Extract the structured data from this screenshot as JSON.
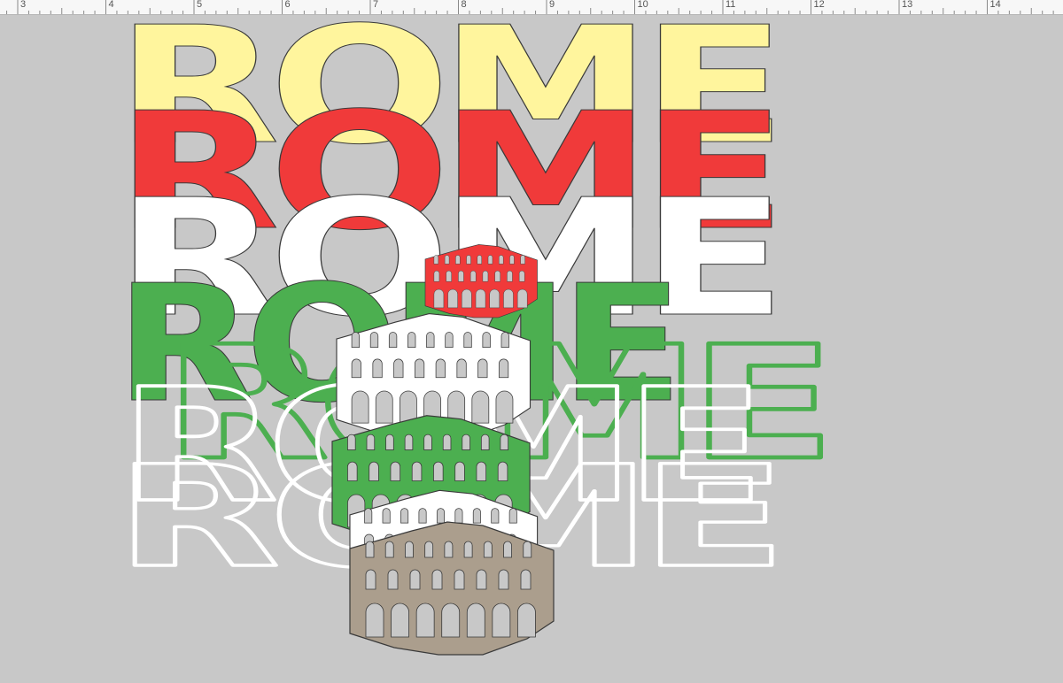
{
  "ruler": {
    "ticks": [
      {
        "label": "3",
        "value": 3
      },
      {
        "label": "4",
        "value": 4
      },
      {
        "label": "5",
        "value": 5
      },
      {
        "label": "6",
        "value": 6
      },
      {
        "label": "7",
        "value": 7
      },
      {
        "label": "8",
        "value": 8
      },
      {
        "label": "9",
        "value": 9
      },
      {
        "label": "10",
        "value": 10
      },
      {
        "label": "11",
        "value": 11
      },
      {
        "label": "12",
        "value": 12
      },
      {
        "label": "13",
        "value": 13
      },
      {
        "label": "14",
        "value": 14
      }
    ]
  },
  "layers": [
    {
      "text": "ROME",
      "color": "#fff59d",
      "style": "filled"
    },
    {
      "text": "ROME",
      "color": "#f03a3a",
      "style": "filled"
    },
    {
      "text": "ROME",
      "color": "#ffffff",
      "style": "filled"
    },
    {
      "text": "ROME",
      "color": "#4caf50",
      "style": "filled"
    },
    {
      "text": "ROME",
      "color": "#4caf50",
      "style": "outline"
    },
    {
      "text": "ROME",
      "color": "#ffffff",
      "style": "outline"
    },
    {
      "text": "ROME",
      "color": "#ffffff",
      "style": "outline"
    }
  ],
  "colosseums": [
    {
      "color": "#f03a3a"
    },
    {
      "color": "#ffffff"
    },
    {
      "color": "#4caf50"
    },
    {
      "color": "#ffffff"
    },
    {
      "color": "#ab9e8d"
    }
  ]
}
